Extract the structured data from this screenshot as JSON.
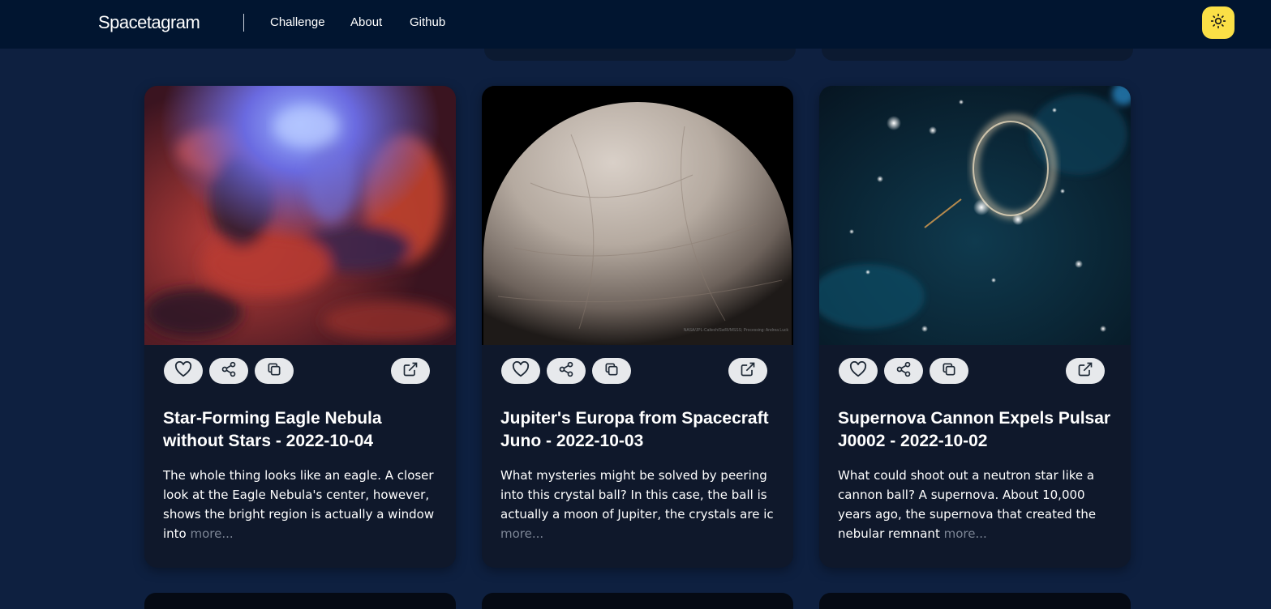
{
  "app": {
    "title": "Spacetagram"
  },
  "nav": {
    "links": [
      {
        "label": "Challenge"
      },
      {
        "label": "About"
      },
      {
        "label": "Github"
      }
    ],
    "theme_toggle_icon": "sun-icon"
  },
  "colors": {
    "page_background": "#0e2040",
    "header_background": "#011530",
    "card_background": "#0f182b",
    "action_button": "#e7e9ec",
    "theme_button": "#fbe046",
    "more_link": "#7c8595"
  },
  "card_actions": {
    "icons": [
      "heart-icon",
      "share-icon",
      "copy-icon",
      "external-link-icon"
    ]
  },
  "cards": [
    {
      "title": "Star-Forming Eagle Nebula without Stars - 2022-10-04",
      "description": "The whole thing looks like an eagle. A closer look at the Eagle Nebula's center, however, shows the bright region is actually a window into",
      "more_label": "more..."
    },
    {
      "title": "Jupiter's Europa from Spacecraft Juno - 2022-10-03",
      "description": "What mysteries might be solved by peering into this crystal ball? In this case, the ball is actually a moon of Jupiter, the crystals are ic",
      "more_label": "more...",
      "image_credit": "NASA/JPL-Caltech/SwRI/MSSS; Processing: Andrea Luck"
    },
    {
      "title": "Supernova Cannon Expels Pulsar J0002 - 2022-10-02",
      "description": "What could shoot out a neutron star like a cannon ball? A supernova. About 10,000 years ago, the supernova that created the nebular remnant",
      "more_label": "more..."
    }
  ]
}
